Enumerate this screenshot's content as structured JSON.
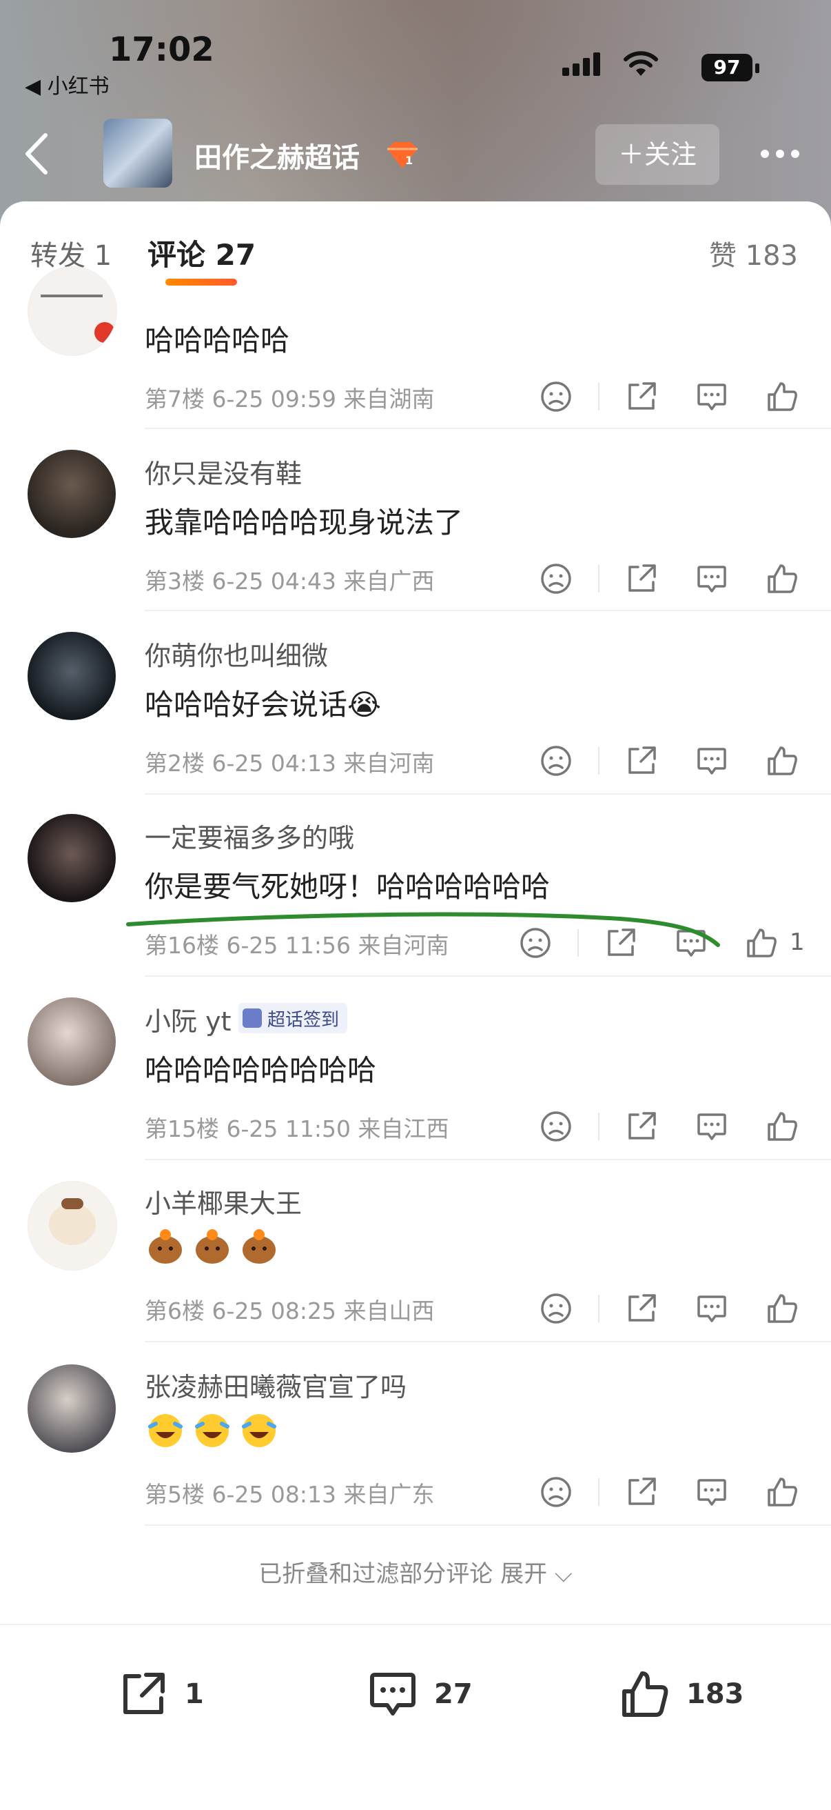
{
  "status_bar": {
    "time": "17:02",
    "back_app": "◀ 小红书",
    "battery": "97"
  },
  "nav": {
    "title": "田作之赫超话",
    "follow_label": "＋关注"
  },
  "tabs": {
    "repost": "转发 1",
    "comment": "评论 27",
    "likes": "赞 183"
  },
  "comments": [
    {
      "name": "",
      "text": "哈哈哈哈哈",
      "meta": "第7楼 6-25 09:59 来自湖南",
      "likes": ""
    },
    {
      "name": "你只是没有鞋",
      "text": "我靠哈哈哈哈现身说法了",
      "meta": "第3楼 6-25 04:43 来自广西",
      "likes": ""
    },
    {
      "name": "你萌你也叫细微",
      "text": "哈哈哈好会说话😭",
      "meta": "第2楼 6-25 04:13 来自河南",
      "likes": ""
    },
    {
      "name": "一定要福多多的哦",
      "text": "你是要气死她呀！哈哈哈哈哈哈",
      "meta": "第16楼 6-25 11:56 来自河南",
      "likes": "1"
    },
    {
      "name": "小阮 yt",
      "badge": "超话签到",
      "text": "哈哈哈哈哈哈哈哈",
      "meta": "第15楼 6-25 11:50 来自江西",
      "likes": ""
    },
    {
      "name": "小羊椰果大王",
      "text": "",
      "meta": "第6楼 6-25 08:25 来自山西",
      "likes": ""
    },
    {
      "name": "张凌赫田曦薇官宣了吗",
      "text": "",
      "meta": "第5楼 6-25 08:13 来自广东",
      "likes": ""
    }
  ],
  "folded_label": "已折叠和过滤部分评论 展开 ⌵",
  "bottom_bar": {
    "repost_count": "1",
    "comment_count": "27",
    "like_count": "183"
  },
  "colors": {
    "accent": "#ff6a1a",
    "annotation": "#2e8b2e"
  }
}
